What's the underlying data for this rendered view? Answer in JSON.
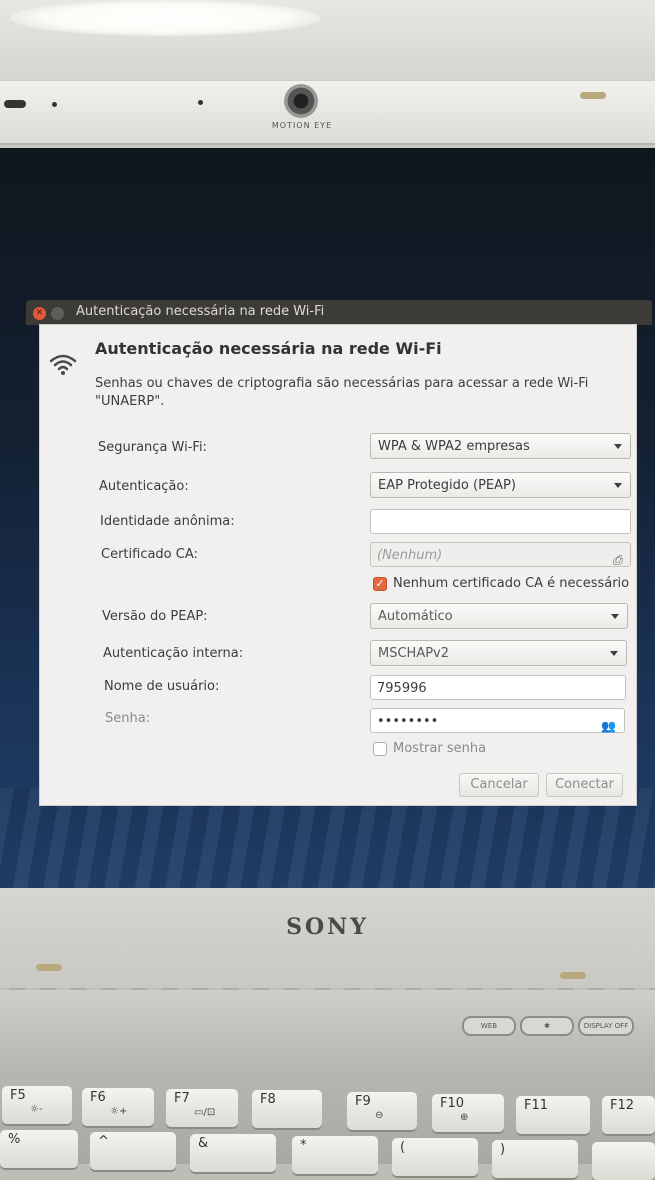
{
  "laptop": {
    "webcam_label": "MOTION EYE",
    "brand": "SONY",
    "deck_buttons": [
      "WEB",
      "✱",
      "DISPLAY OFF"
    ],
    "function_keys": [
      {
        "label": "F5",
        "sub": "☼-"
      },
      {
        "label": "F6",
        "sub": "☼+"
      },
      {
        "label": "F7",
        "sub": "▭/⊡"
      },
      {
        "label": "F8",
        "sub": ""
      },
      {
        "label": "F9",
        "sub": "⊖"
      },
      {
        "label": "F10",
        "sub": "⊕"
      },
      {
        "label": "F11",
        "sub": ""
      },
      {
        "label": "F12",
        "sub": ""
      }
    ],
    "bottom_keys": [
      "%",
      "^",
      "&",
      "*",
      "(",
      ")",
      ""
    ]
  },
  "window": {
    "title": "Autenticação necessária na rede Wi-Fi"
  },
  "dialog": {
    "icon": "wifi-icon",
    "heading": "Autenticação necessária na rede Wi-Fi",
    "description": "Senhas ou chaves de criptografia são necessárias para acessar a rede Wi-Fi \"UNAERP\".",
    "fields": {
      "security_label": "Segurança Wi-Fi:",
      "security_value": "WPA & WPA2 empresas",
      "auth_label": "Autenticação:",
      "auth_value": "EAP Protegido (PEAP)",
      "anon_label": "Identidade anônima:",
      "anon_value": "",
      "ca_label": "Certificado CA:",
      "ca_value": "(Nenhum)",
      "no_ca_label": "Nenhum certificado CA é necessário",
      "no_ca_checked": true,
      "peap_label": "Versão do PEAP:",
      "peap_value": "Automático",
      "inner_label": "Autenticação interna:",
      "inner_value": "MSCHAPv2",
      "user_label": "Nome de usuário:",
      "user_value": "795996",
      "password_label": "Senha:",
      "password_value": "••••••••",
      "show_password_label": "Mostrar senha",
      "show_password_checked": false
    },
    "buttons": {
      "cancel": "Cancelar",
      "connect": "Conectar"
    }
  },
  "colors": {
    "titlebar": "#3c3b37",
    "close_button": "#e05a3a",
    "checkbox_accent": "#e2693f",
    "dialog_bg": "#f1f0ee"
  }
}
